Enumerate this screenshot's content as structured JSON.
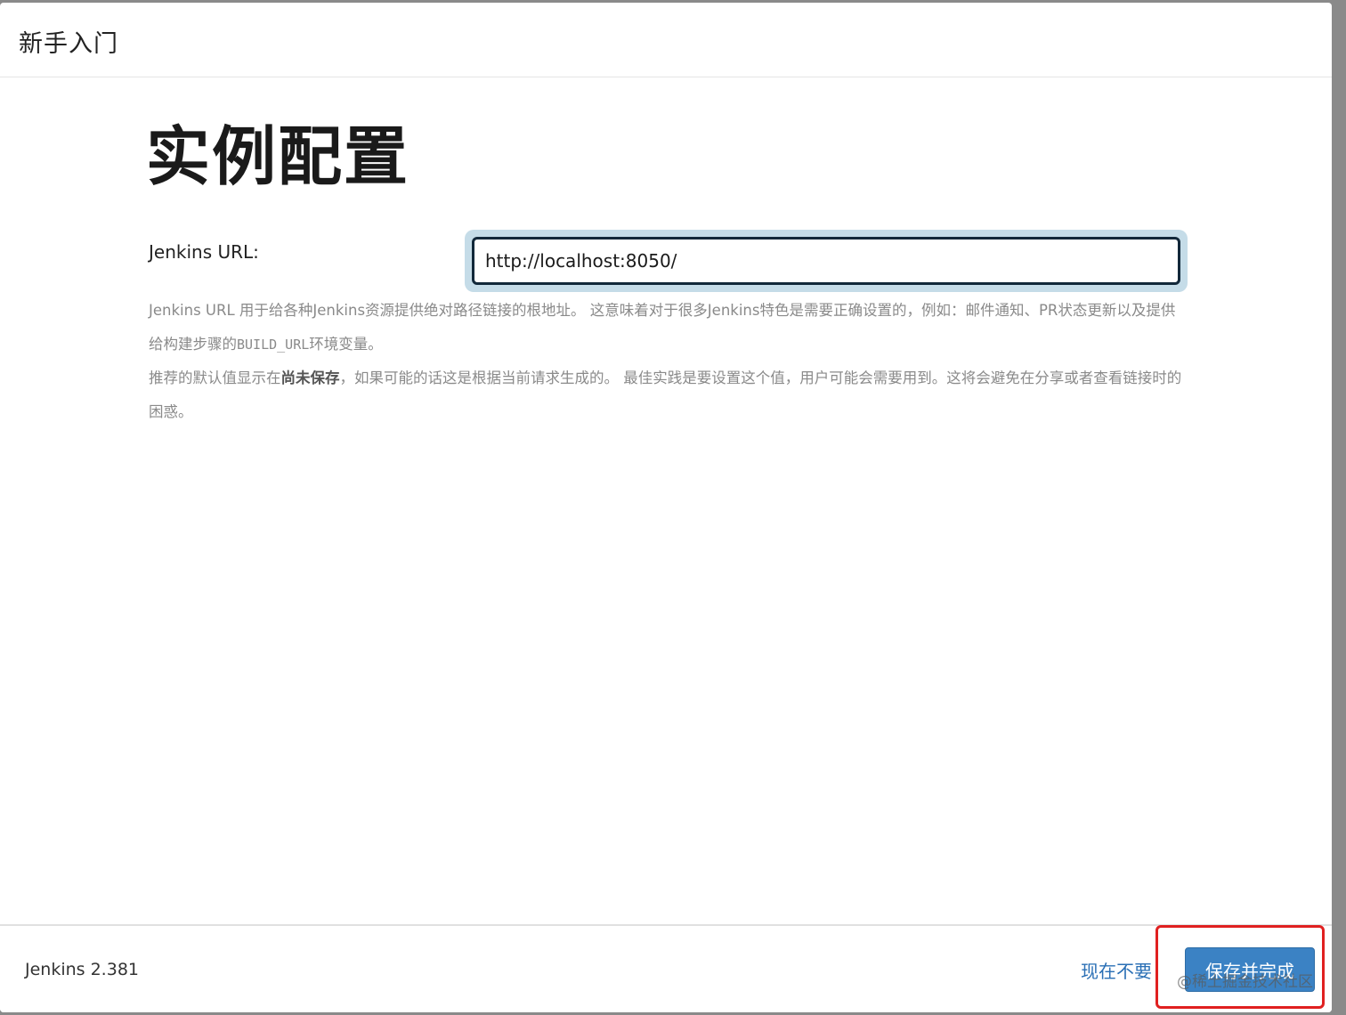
{
  "header": {
    "title": "新手入门"
  },
  "main": {
    "page_title": "实例配置",
    "url_label": "Jenkins URL:",
    "url_value": "http://localhost:8050/",
    "help": {
      "p1_a": "Jenkins URL 用于给各种Jenkins资源提供绝对路径链接的根地址。 这意味着对于很多Jenkins特色是需要正确设置的，例如：邮件通知、PR状态更新以及提供给构建步骤的",
      "p1_code": "BUILD_URL",
      "p1_b": "环境变量。",
      "p2_a": "推荐的默认值显示在",
      "p2_bold": "尚未保存",
      "p2_b": "，如果可能的话这是根据当前请求生成的。 最佳实践是要设置这个值，用户可能会需要用到。这将会避免在分享或者查看链接时的困惑。"
    }
  },
  "footer": {
    "version": "Jenkins 2.381",
    "skip_label": "现在不要",
    "save_label": "保存并完成"
  },
  "overlay": {
    "watermark": "@稀土掘金技术社区",
    "highlight_color": "#e02020"
  },
  "colors": {
    "accent": "#3b82c4",
    "link": "#2a6fb5",
    "input_border": "#12283a"
  }
}
